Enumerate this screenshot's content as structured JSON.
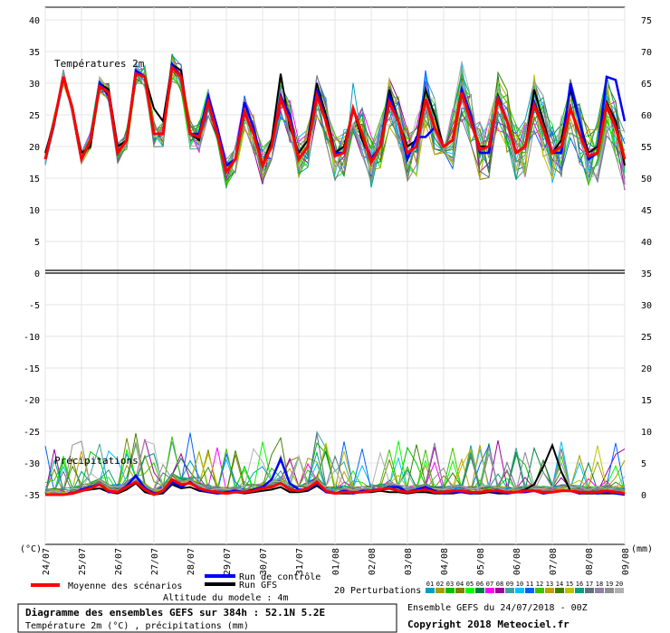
{
  "chart_data": {
    "type": "line",
    "title": "Diagramme des ensembles GEFS sur 384h : 52.1N 5.2E",
    "subtitle": "Température 2m (°C) , précipitations (mm)",
    "panels": {
      "temperature": {
        "label": "Températures 2m",
        "ylim": [
          10,
          40
        ],
        "left_unit": "°C"
      },
      "precipitation": {
        "label": "Précipitations",
        "ylim": [
          0,
          15
        ],
        "unit": "mm"
      }
    },
    "left_axis": {
      "unit": "(°C)",
      "ticks": [
        "40",
        "35",
        "30",
        "25",
        "20",
        "15",
        "10",
        "5",
        "0",
        "-5",
        "-10",
        "-15",
        "-20",
        "-25",
        "-30",
        "-35"
      ]
    },
    "right_axis": {
      "unit": "(mm)",
      "ticks": [
        "75",
        "70",
        "65",
        "60",
        "55",
        "50",
        "45",
        "40",
        "35",
        "30",
        "25",
        "20",
        "15",
        "10",
        "5",
        "0"
      ]
    },
    "x_labels": [
      "24/07",
      "25/07",
      "26/07",
      "27/07",
      "28/07",
      "29/07",
      "30/07",
      "31/07",
      "01/08",
      "02/08",
      "03/08",
      "04/08",
      "05/08",
      "06/08",
      "07/08",
      "08/08",
      "09/08"
    ],
    "x_step_hours": 6,
    "x": [
      0,
      6,
      12,
      18,
      24,
      30,
      36,
      42,
      48,
      54,
      60,
      66,
      72,
      78,
      84,
      90,
      96,
      102,
      108,
      114,
      120,
      126,
      132,
      138,
      144,
      150,
      156,
      162,
      168,
      174,
      180,
      186,
      192,
      198,
      204,
      210,
      216,
      222,
      228,
      234,
      240,
      246,
      252,
      258,
      264,
      270,
      276,
      282,
      288,
      294,
      300,
      306,
      312,
      318,
      324,
      330,
      336,
      342,
      348,
      354,
      360,
      366,
      372,
      378,
      384
    ],
    "temperature_series": [
      {
        "name": "Moyenne des scénarios",
        "color": "#ff0000",
        "values": [
          18,
          24,
          31,
          26,
          18,
          21,
          29.5,
          28.5,
          19,
          21,
          31.5,
          31,
          22,
          22,
          32.5,
          31,
          22,
          21.5,
          27,
          22,
          16,
          18,
          25.5,
          22,
          17,
          20,
          27.5,
          24,
          18,
          20,
          28,
          24,
          18.5,
          19,
          26,
          22,
          17.5,
          20,
          27,
          24,
          19,
          20,
          27.5,
          23,
          20,
          21,
          28.5,
          24,
          19.5,
          20,
          27.5,
          24,
          19,
          20,
          26.5,
          23,
          19,
          20,
          26,
          22,
          18.5,
          19,
          26.5,
          23,
          18
        ]
      },
      {
        "name": "Run de contrôle",
        "color": "#0000ff",
        "values": [
          18,
          24,
          31,
          26,
          18,
          21,
          30,
          28,
          19,
          21,
          32,
          31,
          22,
          22,
          33,
          31,
          22,
          22,
          28,
          23,
          17,
          18,
          27,
          23,
          17,
          20,
          28,
          25,
          18,
          20,
          29,
          24,
          19,
          19,
          26,
          22,
          18,
          20,
          28,
          24,
          18,
          21.5,
          21.5,
          23,
          20,
          21,
          29,
          25,
          19,
          19,
          28,
          24,
          19,
          20,
          27,
          23,
          19,
          19,
          30,
          24,
          18,
          19,
          31,
          30.5,
          24
        ]
      },
      {
        "name": "Run GFS",
        "color": "#000000",
        "values": [
          19,
          24,
          31,
          26,
          19,
          20,
          30,
          29,
          20,
          21,
          32,
          31,
          26,
          24,
          33,
          32,
          22,
          21,
          28,
          22,
          17,
          18,
          27,
          23,
          17,
          21,
          31.5,
          23,
          19,
          21,
          30,
          25,
          19,
          20,
          26,
          21,
          18,
          20,
          29,
          24,
          20,
          21,
          29,
          25,
          20,
          21,
          29,
          24,
          20,
          20,
          28,
          24,
          19,
          20,
          29,
          24,
          19,
          21,
          29,
          24,
          19,
          20,
          27,
          24,
          17
        ]
      }
    ],
    "precipitation_series": [
      {
        "name": "Moyenne des scénarios",
        "color": "#ff0000",
        "values": [
          0,
          0,
          0,
          0.1,
          0.3,
          0.5,
          0.8,
          0.3,
          0.2,
          0.6,
          1.0,
          0.4,
          0,
          0.3,
          1.2,
          0.8,
          0.9,
          0.5,
          0.3,
          0.2,
          0.1,
          0.2,
          0.2,
          0.3,
          0.5,
          0.6,
          0.9,
          0.4,
          0.3,
          0.5,
          1.0,
          0.3,
          0.1,
          0.2,
          0.2,
          0.2,
          0.3,
          0.4,
          0.5,
          0.3,
          0.2,
          0.3,
          0.4,
          0.2,
          0.2,
          0.3,
          0.3,
          0.2,
          0.2,
          0.3,
          0.3,
          0.2,
          0.2,
          0.3,
          0.3,
          0.2,
          0.2,
          0.3,
          0.3,
          0.2,
          0.2,
          0.2,
          0.3,
          0.2,
          0.1
        ]
      },
      {
        "name": "Run de contrôle",
        "color": "#0000ff",
        "values": [
          0,
          0,
          0,
          0.1,
          0.4,
          0.6,
          0.8,
          0.2,
          0.2,
          0.7,
          1.5,
          0.5,
          0.1,
          0.2,
          1.0,
          0.6,
          1.0,
          0.4,
          0.2,
          0.1,
          0.2,
          0.3,
          0.2,
          0.4,
          0.6,
          1.2,
          2.8,
          0.9,
          0.4,
          0.4,
          0.9,
          0.2,
          0.1,
          0.3,
          0.1,
          0.3,
          0.3,
          0.4,
          0.6,
          0.6,
          0.2,
          0.4,
          0.6,
          0.3,
          0.1,
          0.2,
          0.2,
          0.1,
          0.2,
          0.3,
          0.2,
          0.1,
          0.2,
          0.2,
          0.3,
          0.1,
          0.2,
          0.3,
          0.3,
          0.1,
          0.2,
          0.1,
          0.2,
          0.1,
          0
        ]
      },
      {
        "name": "Run GFS",
        "color": "#000000",
        "values": [
          0,
          0,
          0,
          0.1,
          0.3,
          0.4,
          0.5,
          0.2,
          0.1,
          0.4,
          0.9,
          0.2,
          0,
          0.1,
          0.8,
          0.5,
          0.6,
          0.3,
          0.2,
          0.1,
          0.1,
          0.2,
          0.1,
          0.2,
          0.3,
          0.4,
          0.6,
          0.2,
          0.2,
          0.3,
          0.7,
          0.2,
          0.1,
          0.1,
          0.1,
          0.2,
          0.2,
          0.3,
          0.2,
          0.2,
          0.1,
          0.2,
          0.2,
          0.1,
          0.1,
          0.1,
          0.2,
          0.1,
          0.1,
          0.2,
          0.1,
          0.1,
          0.2,
          0.4,
          0.8,
          2.2,
          3.9,
          1.8,
          0.3,
          0.1,
          0.1,
          0.1,
          0.1,
          0.1,
          0
        ]
      }
    ],
    "perturbations_count": 20,
    "perturbation_colors": [
      "#00a0c0",
      "#a0a000",
      "#00c000",
      "#808000",
      "#00ff00",
      "#008040",
      "#ff00ff",
      "#a000a0",
      "#40a0a0",
      "#00c0ff",
      "#0060ff",
      "#40c000",
      "#c0a000",
      "#408000",
      "#c0c000",
      "#00a080",
      "#607080",
      "#9080a0",
      "#909090",
      "#b0b0b0"
    ]
  },
  "legend": {
    "mean_label": "Moyenne des scénarios",
    "control_label": "Run de contrôle",
    "gfs_label": "Run GFS",
    "perturbations_label": "20 Perturbations",
    "perturbation_numbers": [
      "01",
      "02",
      "03",
      "04",
      "05",
      "06",
      "07",
      "08",
      "09",
      "10",
      "11",
      "12",
      "13",
      "14",
      "15",
      "16",
      "17",
      "18",
      "19",
      "20"
    ]
  },
  "footer": {
    "altitude": "Altitude du modele : 4m",
    "title": "Diagramme des ensembles GEFS sur 384h : 52.1N 5.2E",
    "subtitle": "Température 2m (°C) , précipitations (mm)",
    "ensemble": "Ensemble GEFS du 24/07/2018 - 00Z",
    "copyright": "Copyright 2018 Meteociel.fr"
  }
}
